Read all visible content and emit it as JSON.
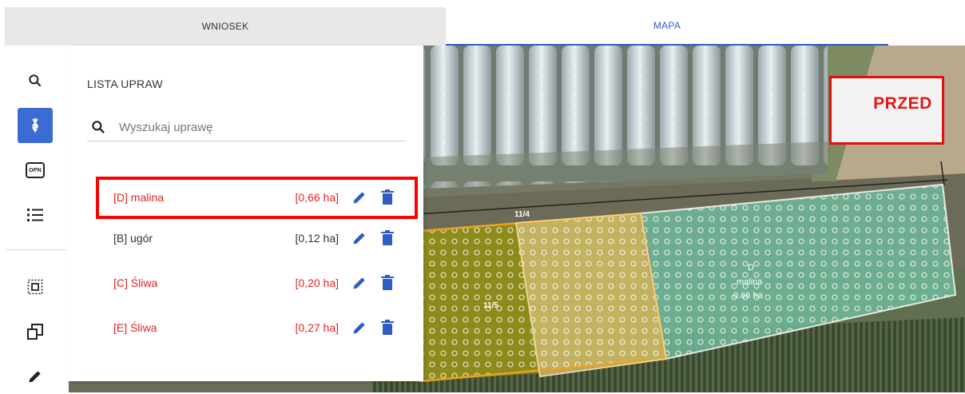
{
  "tabs": {
    "left": "WNIOSEK",
    "right": "MAPA",
    "active": "MAPA"
  },
  "panel": {
    "title": "LISTA UPRAW",
    "search_placeholder": "Wyszukaj uprawę",
    "crops": [
      {
        "name": "[D] malina",
        "area": "[0,66 ha]",
        "color": "#e02424",
        "selected": true
      },
      {
        "name": "[B] ugór",
        "area": "[0,12 ha]",
        "color": "#333333",
        "selected": false
      },
      {
        "name": "[C] Śliwa",
        "area": "[0,20 ha]",
        "color": "#e02424",
        "selected": false
      },
      {
        "name": "[E] Śliwa",
        "area": "[0,27 ha]",
        "color": "#e02424",
        "selected": false
      }
    ]
  },
  "toolbar": {
    "icons": [
      "search-icon",
      "crop-icon",
      "opn-icon",
      "list-icon",
      "select-area-icon",
      "copy-icon",
      "pencil-icon"
    ],
    "opn_label": "OPN",
    "active": "crop-icon"
  },
  "map": {
    "before_label": "PRZED",
    "parcel_label_1": "11/4",
    "parcel_label_2": "11/5",
    "field_code": "D",
    "field_crop": "malina",
    "field_area": "0.66 ha"
  },
  "colors": {
    "accent": "#3b6cd4",
    "warning": "#e02424",
    "icon": "#2f5dc4"
  }
}
